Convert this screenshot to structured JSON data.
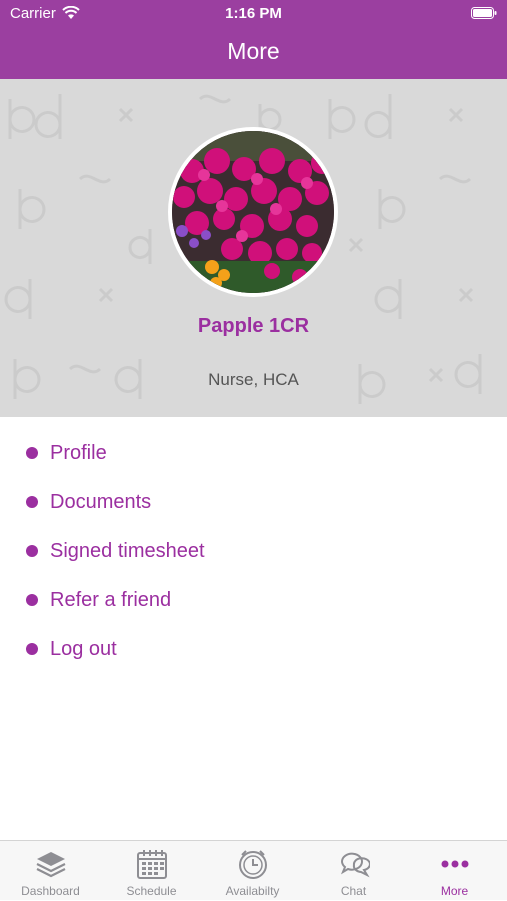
{
  "status_bar": {
    "carrier": "Carrier",
    "time": "1:16 PM",
    "wifi_icon": "wifi-icon",
    "battery_icon": "battery-icon"
  },
  "nav": {
    "title": "More"
  },
  "profile": {
    "name": "Papple 1CR",
    "role": "Nurse, HCA",
    "avatar": "flower-photo"
  },
  "menu": {
    "items": [
      {
        "label": "Profile"
      },
      {
        "label": "Documents"
      },
      {
        "label": "Signed timesheet"
      },
      {
        "label": "Refer a friend"
      },
      {
        "label": "Log out"
      }
    ]
  },
  "tabbar": {
    "active_index": 4,
    "tabs": [
      {
        "label": "Dashboard",
        "icon": "layers-icon"
      },
      {
        "label": "Schedule",
        "icon": "calendar-icon"
      },
      {
        "label": "Availabilty",
        "icon": "clock-icon"
      },
      {
        "label": "Chat",
        "icon": "chat-bubbles-icon"
      },
      {
        "label": "More",
        "icon": "more-dots-icon"
      }
    ]
  },
  "colors": {
    "brand": "#9b3fa0",
    "accent_text": "#9b2fa0",
    "header_bg": "#d9d9d9",
    "tab_inactive": "#8e8e93"
  }
}
